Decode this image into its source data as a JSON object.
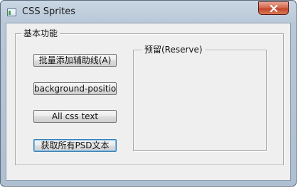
{
  "window": {
    "title": "CSS Sprites",
    "icon": "app-window-icon",
    "close_icon": "close-icon"
  },
  "basic_group": {
    "label": "基本功能",
    "buttons": [
      {
        "label": "批量添加辅助线(A)"
      },
      {
        "label": "background-position"
      },
      {
        "label": "All css text"
      },
      {
        "label": "获取所有PSD文本"
      }
    ]
  },
  "reserve_group": {
    "label": "预留(Reserve)"
  },
  "colors": {
    "close_button": "#c2452a",
    "frame": "#b9c8d8",
    "client_bg": "#efefef"
  }
}
